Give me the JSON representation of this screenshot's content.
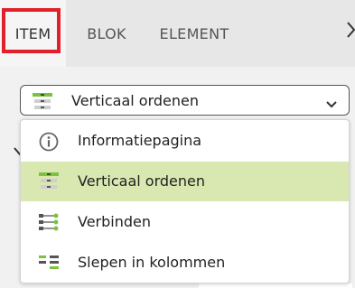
{
  "tabs": {
    "item": "ITEM",
    "blok": "BLOK",
    "element": "ELEMENT",
    "more": "›"
  },
  "select": {
    "value": "Verticaal ordenen",
    "icon": "vertical-order-icon"
  },
  "dropdown": {
    "options": [
      {
        "label": "Informatiepagina",
        "icon": "info-icon",
        "selected": false
      },
      {
        "label": "Verticaal ordenen",
        "icon": "vertical-order-icon",
        "selected": true
      },
      {
        "label": "Verbinden",
        "icon": "connect-icon",
        "selected": false
      },
      {
        "label": "Slepen in kolommen",
        "icon": "columns-drag-icon",
        "selected": false
      }
    ]
  },
  "colors": {
    "active_tab_highlight": "#e0202a",
    "selected_option": "#d9e8b0",
    "icon_green": "#7cc242"
  }
}
